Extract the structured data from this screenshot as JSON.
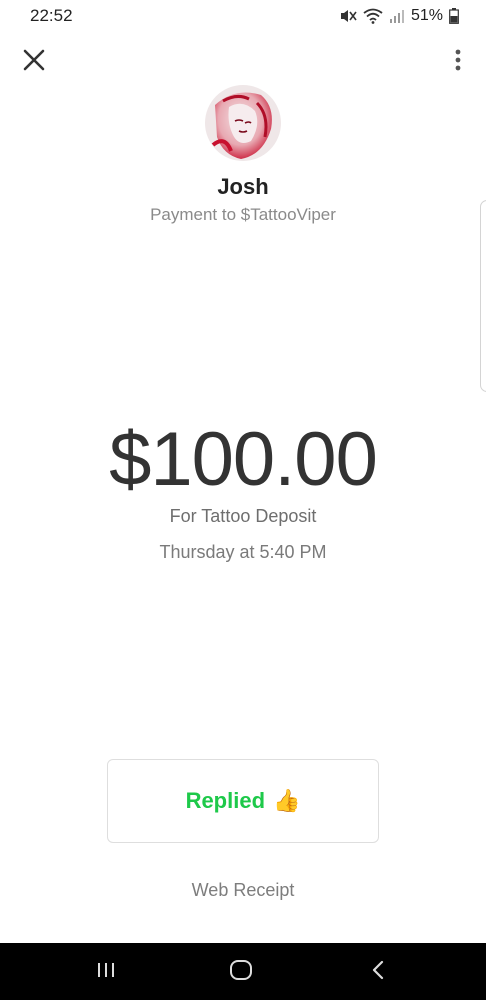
{
  "status_bar": {
    "time": "22:52",
    "battery_percent": "51%",
    "icons": [
      "mute-icon",
      "wifi-icon",
      "signal-icon",
      "battery-icon"
    ]
  },
  "header": {
    "close_icon": "close-icon",
    "more_icon": "more-vertical-icon"
  },
  "recipient": {
    "name": "Josh",
    "subtitle": "Payment to $TattooViper",
    "avatar": "avatar-image"
  },
  "payment": {
    "amount": "$100.00",
    "memo": "For Tattoo Deposit",
    "timestamp": "Thursday at 5:40 PM"
  },
  "reply": {
    "label": "Replied",
    "emoji": "👍"
  },
  "footer": {
    "link": "Web Receipt"
  },
  "nav_bar": {
    "icons": [
      "recents-icon",
      "home-icon",
      "back-icon"
    ]
  },
  "colors": {
    "accent_green": "#1ec94a",
    "avatar_red": "#c8102e",
    "navbar_bg": "#000000"
  }
}
